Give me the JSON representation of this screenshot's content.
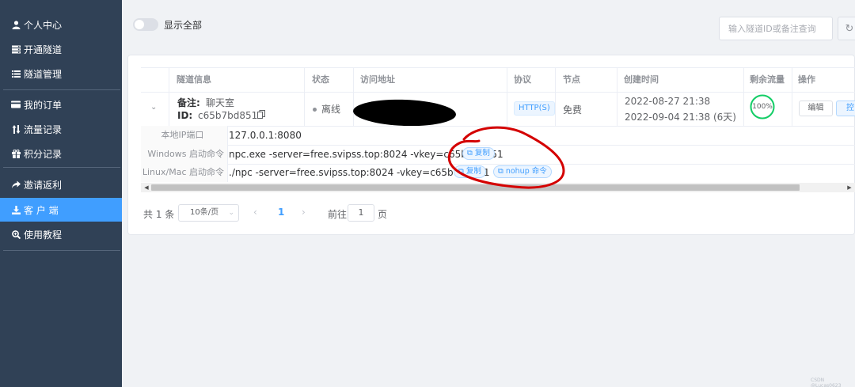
{
  "sidebar": {
    "items": [
      {
        "label": "个人中心",
        "icon": "user-icon"
      },
      {
        "label": "开通隧道",
        "icon": "server-icon"
      },
      {
        "label": "隧道管理",
        "icon": "list-icon"
      },
      {
        "label": "我的订单",
        "icon": "credit-card-icon"
      },
      {
        "label": "流量记录",
        "icon": "sort-arrows-icon"
      },
      {
        "label": "积分记录",
        "icon": "gift-icon"
      },
      {
        "label": "邀请返利",
        "icon": "share-icon"
      },
      {
        "label": "客 户 端",
        "icon": "download-icon"
      },
      {
        "label": "使用教程",
        "icon": "search-plus-icon"
      }
    ],
    "active_index": 7
  },
  "toolbar": {
    "show_all_label": "显示全部",
    "show_all_on": false,
    "search_placeholder": "输入隧道ID或备注查询"
  },
  "table": {
    "headers": [
      "隧道信息",
      "状态",
      "访问地址",
      "协议",
      "节点",
      "创建时间",
      "剩余流量",
      "操作"
    ],
    "row": {
      "remark_label": "备注:",
      "remark_value": "聊天室",
      "id_label": "ID:",
      "id_value": "c65b7bd851",
      "status": "离线",
      "protocol": "HTTP(S)",
      "node": "免费",
      "created": "2022-08-27 21:38",
      "expires": "2022-09-04 21:38 (6天)",
      "traffic_percent": 100,
      "traffic_label": "100%",
      "edit_label": "编辑",
      "control_label": "控"
    },
    "details": {
      "local_ip_label": "本地IP端口",
      "local_ip_value": "127.0.0.1:8080",
      "windows_label": "Windows 启动命令",
      "windows_value": "npc.exe -server=free.svipss.top:8024 -vkey=c65b7bd851",
      "linux_label": "Linux/Mac 启动命令",
      "linux_value": "./npc -server=free.svipss.top:8024 -vkey=c65b7bd851",
      "copy_label": "复制",
      "nohup_label": "nohup 命令"
    }
  },
  "pagination": {
    "total": "共 1 条",
    "page_size": "10条/页",
    "current": "1",
    "goto_label": "前往",
    "goto_value": "1",
    "unit": "页"
  },
  "watermark": "CSDN @Lucas0623",
  "colors": {
    "sidebar_bg": "#304156",
    "active": "#409eff",
    "annotation": "#d40000"
  }
}
